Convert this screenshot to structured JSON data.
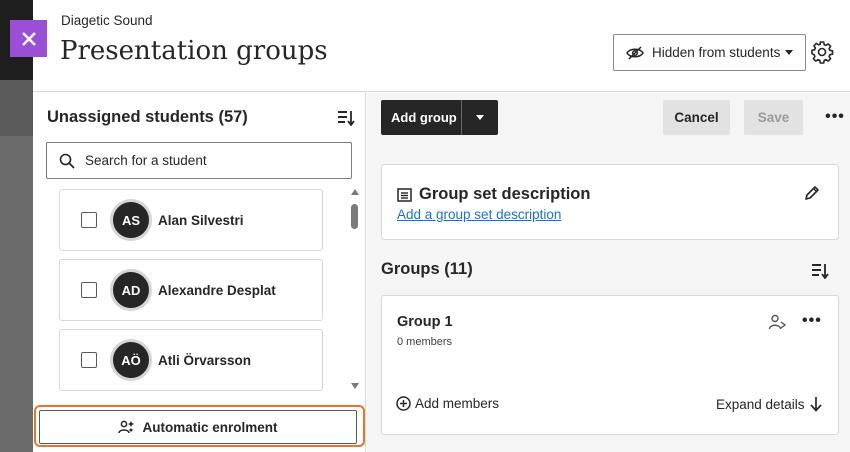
{
  "header": {
    "course_name": "Diagetic Sound",
    "title": "Presentation groups",
    "visibility_label": "Hidden from students"
  },
  "left_panel": {
    "title": "Unassigned students (57)",
    "search_placeholder": "Search for a student",
    "students": [
      {
        "initials": "AS",
        "name": "Alan Silvestri"
      },
      {
        "initials": "AD",
        "name": "Alexandre Desplat"
      },
      {
        "initials": "AÖ",
        "name": "Atli Örvarsson"
      }
    ],
    "auto_enrol_label": "Automatic enrolment"
  },
  "right_panel": {
    "add_group_label": "Add group",
    "cancel_label": "Cancel",
    "save_label": "Save",
    "more_label": "•••",
    "description": {
      "title": "Group set description",
      "link": "Add a group set description"
    },
    "groups_title": "Groups (11)",
    "groups": [
      {
        "name": "Group 1",
        "members": "0 members",
        "add_members": "Add members",
        "expand": "Expand details",
        "more": "•••"
      }
    ]
  },
  "colors": {
    "close_button": "#9b4fd6",
    "highlight": "#e8752b",
    "link": "#1a73c7",
    "dark": "#262626"
  },
  "icons": [
    "close-icon",
    "eye-slash-icon",
    "gear-icon",
    "sort-icon",
    "search-icon",
    "people-auto-icon",
    "list-icon",
    "pencil-icon",
    "person-assign-icon",
    "plus-circle-icon",
    "arrow-down-icon"
  ]
}
